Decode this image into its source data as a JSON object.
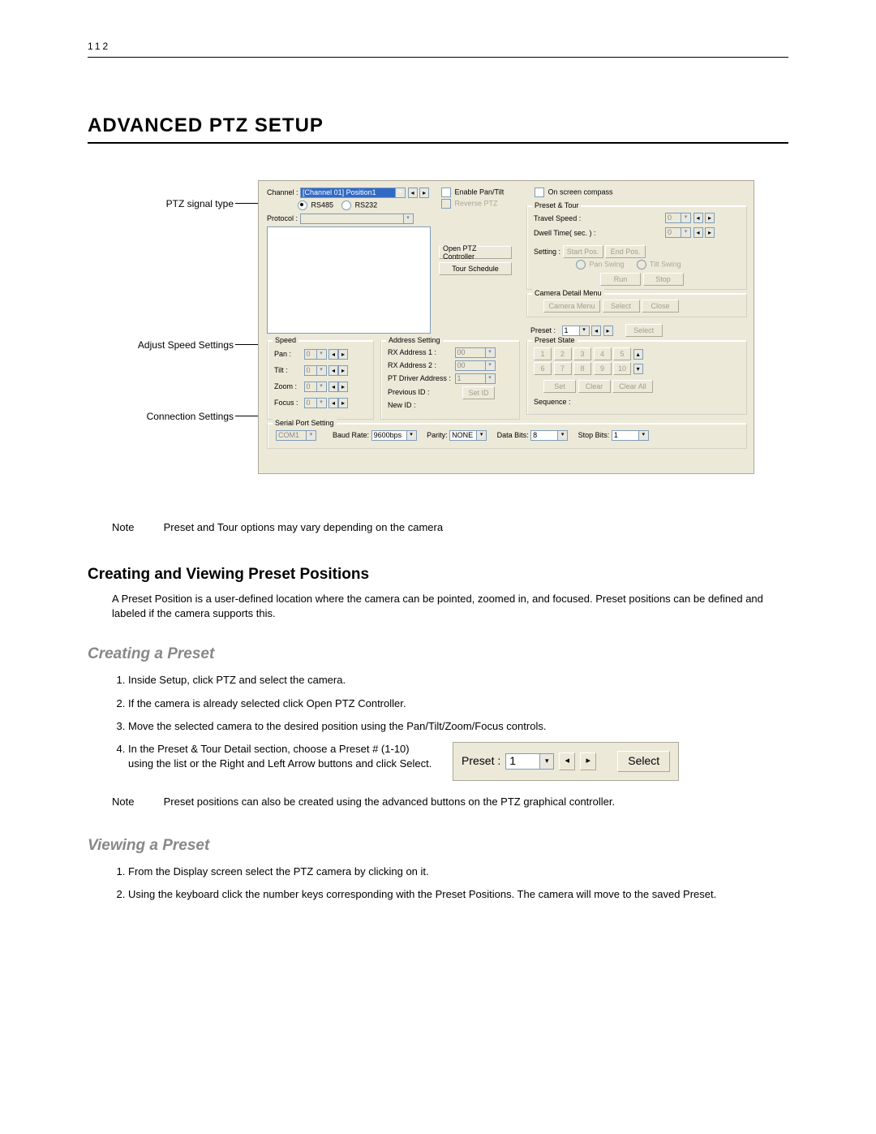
{
  "page_number": "112",
  "title": "ADVANCED PTZ SETUP",
  "callouts": {
    "signal": "PTZ signal type",
    "speed": "Adjust Speed Settings",
    "conn": "Connection Settings"
  },
  "dialog": {
    "channel_label": "Channel :",
    "channel_value": "[Channel 01]  Position1",
    "enable_pantilt": "Enable Pan/Tilt",
    "reverse_ptz": "Reverse PTZ",
    "on_screen_compass": "On screen compass",
    "rs485": "RS485",
    "rs232": "RS232",
    "protocol_label": "Protocol :",
    "open_ptz": "Open PTZ Controller",
    "tour_schedule": "Tour Schedule",
    "preset_tour": {
      "legend": "Preset & Tour",
      "travel_speed": "Travel Speed :",
      "dwell_time": "Dwell Time( sec. ) :",
      "setting": "Setting   :",
      "start_pos": "Start Pos.",
      "end_pos": "End Pos.",
      "pan_swing": "Pan Swing",
      "tilt_swing": "Tilt Swing",
      "run": "Run",
      "stop": "Stop",
      "val0a": "0",
      "val0b": "0"
    },
    "camera_detail": {
      "legend": "Camera Detail Menu",
      "camera_menu": "Camera Menu",
      "select": "Select",
      "close": "Close"
    },
    "preset_line": {
      "label": "Preset :",
      "value": "1",
      "select": "Select"
    },
    "preset_state": {
      "legend": "Preset State",
      "b1": "1",
      "b2": "2",
      "b3": "3",
      "b4": "4",
      "b5": "5",
      "b6": "6",
      "b7": "7",
      "b8": "8",
      "b9": "9",
      "b10": "10",
      "set": "Set",
      "clear": "Clear",
      "clear_all": "Clear All",
      "sequence": "Sequence :"
    },
    "speed": {
      "legend": "Speed",
      "pan": "Pan :",
      "tilt": "Tilt :",
      "zoom": "Zoom :",
      "focus": "Focus :",
      "v": "0"
    },
    "address": {
      "legend": "Address Setting",
      "rx1": "RX Address 1 :",
      "rx1v": "00",
      "rx2": "RX Address 2 :",
      "rx2v": "00",
      "ptdrv": "PT Driver Address :",
      "ptdrvv": "1",
      "prev": "Previous ID :",
      "newid": "New ID :",
      "setid": "Set ID"
    },
    "serial": {
      "legend": "Serial Port Setting",
      "com": "COM1",
      "baud_label": "Baud Rate:",
      "baud": "9600bps",
      "parity_label": "Parity:",
      "parity": "NONE",
      "databits_label": "Data Bits:",
      "databits": "8",
      "stopbits_label": "Stop Bits:",
      "stopbits": "1"
    }
  },
  "note1_label": "Note",
  "note1_text": "Preset and Tour options may vary depending on the camera",
  "section1_title": "Creating and Viewing Preset Positions",
  "section1_text": "A Preset Position is a user-defined location where the camera can be pointed, zoomed in, and focused. Preset positions can be defined and labeled if the camera supports this.",
  "sub_create_title": "Creating a Preset",
  "create_steps": {
    "s1": "Inside Setup, click PTZ and select the camera.",
    "s2": "If the camera is already selected click Open PTZ Controller.",
    "s3": "Move the selected camera to the desired position using the Pan/Tilt/Zoom/Focus controls.",
    "s4": "In the Preset & Tour Detail section, choose a Preset # (1-10) using the list or the Right and Left Arrow buttons and click Select."
  },
  "preset_widget": {
    "label": "Preset :",
    "value": "1",
    "select": "Select"
  },
  "note2_label": "Note",
  "note2_text": "Preset positions can also be created using the advanced buttons on the PTZ graphical controller.",
  "sub_view_title": "Viewing a Preset",
  "view_steps": {
    "s1": "From the Display screen select the PTZ camera by clicking on it.",
    "s2": "Using the keyboard click the number keys corresponding with the Preset Positions. The camera will move to the saved Preset."
  }
}
